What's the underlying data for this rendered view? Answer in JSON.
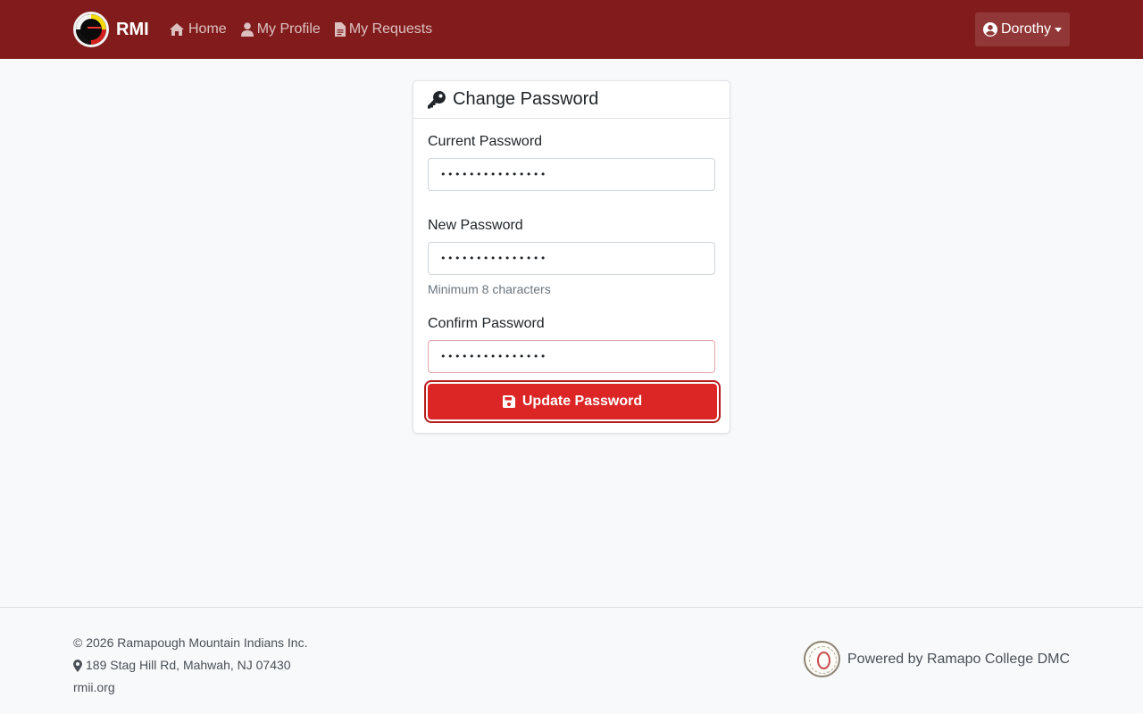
{
  "navbar": {
    "brand": "RMI",
    "links": [
      {
        "label": "Home",
        "icon": "home-icon"
      },
      {
        "label": "My Profile",
        "icon": "user-icon"
      },
      {
        "label": "My Requests",
        "icon": "file-icon"
      }
    ],
    "user": {
      "label": "Dorothy",
      "icon": "user-circle-icon"
    },
    "background_color": "#821c1c"
  },
  "card": {
    "title": "Change Password",
    "title_icon": "key-icon",
    "fields": {
      "current": {
        "label": "Current Password",
        "value": "passwordpasswor"
      },
      "new": {
        "label": "New Password",
        "value": "passwordpasswor",
        "hint": "Minimum 8 characters"
      },
      "confirm": {
        "label": "Confirm Password",
        "value": "passwordpasswor"
      }
    },
    "submit": {
      "label": "Update Password",
      "icon": "save-icon",
      "color": "#dc2626"
    }
  },
  "footer": {
    "copyright": "© 2026 Ramapough Mountain Indians Inc.",
    "address": "189 Stag Hill Rd, Mahwah, NJ 07430",
    "website": "rmii.org",
    "powered_by": "Powered by Ramapo College DMC"
  }
}
